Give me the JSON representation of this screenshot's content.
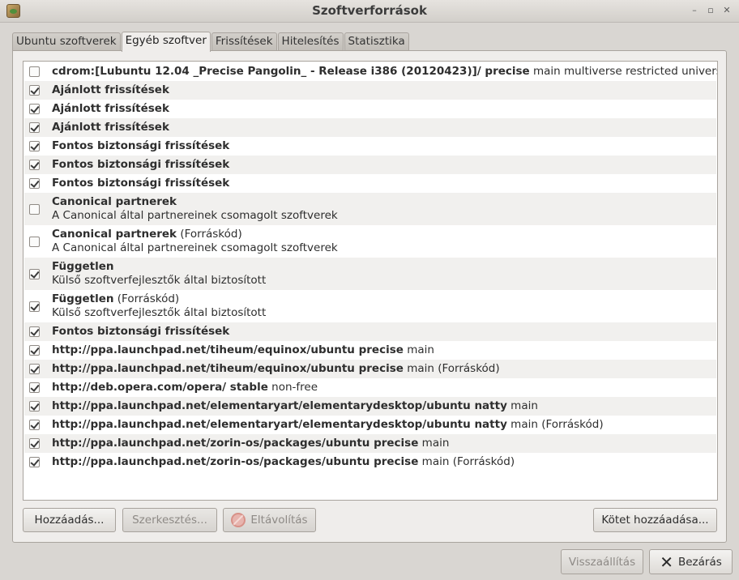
{
  "window": {
    "title": "Szoftverforrások",
    "icon": "software-sources-icon",
    "controls": [
      "–",
      "▫",
      "✕"
    ]
  },
  "tabs": [
    {
      "label": "Ubuntu szoftverek",
      "active": false
    },
    {
      "label": "Egyéb szoftver",
      "active": true
    },
    {
      "label": "Frissítések",
      "active": false
    },
    {
      "label": "Hitelesítés",
      "active": false
    },
    {
      "label": "Statisztika",
      "active": false
    }
  ],
  "sources": [
    {
      "checked": false,
      "bold": "cdrom:[Lubuntu 12.04 _Precise Pangolin_ - Release i386 (20120423)]/ precise",
      "rest": " main multiverse restricted universe",
      "sub": ""
    },
    {
      "checked": true,
      "bold": "Ajánlott frissítések",
      "rest": "",
      "sub": ""
    },
    {
      "checked": true,
      "bold": "Ajánlott frissítések",
      "rest": "",
      "sub": ""
    },
    {
      "checked": true,
      "bold": "Ajánlott frissítések",
      "rest": "",
      "sub": ""
    },
    {
      "checked": true,
      "bold": "Fontos biztonsági frissítések",
      "rest": "",
      "sub": ""
    },
    {
      "checked": true,
      "bold": "Fontos biztonsági frissítések",
      "rest": "",
      "sub": ""
    },
    {
      "checked": true,
      "bold": "Fontos biztonsági frissítések",
      "rest": "",
      "sub": ""
    },
    {
      "checked": false,
      "bold": "Canonical partnerek",
      "rest": "",
      "sub": "A Canonical által partnereinek csomagolt szoftverek"
    },
    {
      "checked": false,
      "bold": "Canonical partnerek",
      "rest": " (Forráskód)",
      "sub": "A Canonical által partnereinek csomagolt szoftverek"
    },
    {
      "checked": true,
      "bold": "Független",
      "rest": "",
      "sub": "Külső szoftverfejlesztők által biztosított"
    },
    {
      "checked": true,
      "bold": "Független",
      "rest": " (Forráskód)",
      "sub": "Külső szoftverfejlesztők által biztosított"
    },
    {
      "checked": true,
      "bold": "Fontos biztonsági frissítések",
      "rest": "",
      "sub": ""
    },
    {
      "checked": true,
      "bold": "http://ppa.launchpad.net/tiheum/equinox/ubuntu precise",
      "rest": " main",
      "sub": ""
    },
    {
      "checked": true,
      "bold": "http://ppa.launchpad.net/tiheum/equinox/ubuntu precise",
      "rest": " main (Forráskód)",
      "sub": ""
    },
    {
      "checked": true,
      "bold": "http://deb.opera.com/opera/ stable",
      "rest": " non-free",
      "sub": ""
    },
    {
      "checked": true,
      "bold": "http://ppa.launchpad.net/elementaryart/elementarydesktop/ubuntu natty",
      "rest": " main",
      "sub": ""
    },
    {
      "checked": true,
      "bold": "http://ppa.launchpad.net/elementaryart/elementarydesktop/ubuntu natty",
      "rest": " main (Forráskód)",
      "sub": ""
    },
    {
      "checked": true,
      "bold": "http://ppa.launchpad.net/zorin-os/packages/ubuntu precise",
      "rest": " main",
      "sub": ""
    },
    {
      "checked": true,
      "bold": "http://ppa.launchpad.net/zorin-os/packages/ubuntu precise",
      "rest": " main (Forráskód)",
      "sub": ""
    }
  ],
  "buttons": {
    "add": "Hozzáadás...",
    "edit": "Szerkesztés...",
    "remove": "Eltávolítás",
    "add_volume": "Kötet hozzáadása...",
    "revert": "Visszaállítás",
    "close": "Bezárás"
  }
}
